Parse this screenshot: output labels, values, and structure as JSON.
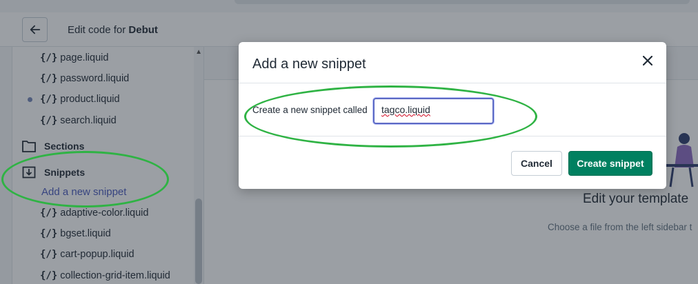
{
  "header": {
    "title_prefix": "Edit code for",
    "theme_name": "Debut"
  },
  "sidebar": {
    "files_top": [
      {
        "label": "page.liquid"
      },
      {
        "label": "password.liquid"
      },
      {
        "label": "product.liquid"
      },
      {
        "label": "search.liquid"
      }
    ],
    "sections_label": "Sections",
    "snippets_label": "Snippets",
    "add_snippet_link": "Add a new snippet",
    "snippet_files": [
      {
        "label": "adaptive-color.liquid"
      },
      {
        "label": "bgset.liquid"
      },
      {
        "label": "cart-popup.liquid"
      },
      {
        "label": "collection-grid-item.liquid"
      }
    ]
  },
  "main": {
    "empty_title": "Edit your template",
    "empty_subtitle": "Choose a file from the left sidebar t"
  },
  "modal": {
    "title": "Add a new snippet",
    "field_label": "Create a new snippet called",
    "field_value": "tagco.liquid",
    "cancel_label": "Cancel",
    "create_label": "Create snippet"
  },
  "icons": {
    "back": "arrow-left-icon",
    "close": "close-icon",
    "file": "code-file-icon",
    "folder": "folder-icon",
    "folder_open": "folder-download-icon"
  },
  "colors": {
    "primary_button": "#008060",
    "link": "#4959bd",
    "focus_ring": "#5c6ac4",
    "annotation": "#2fb344"
  }
}
